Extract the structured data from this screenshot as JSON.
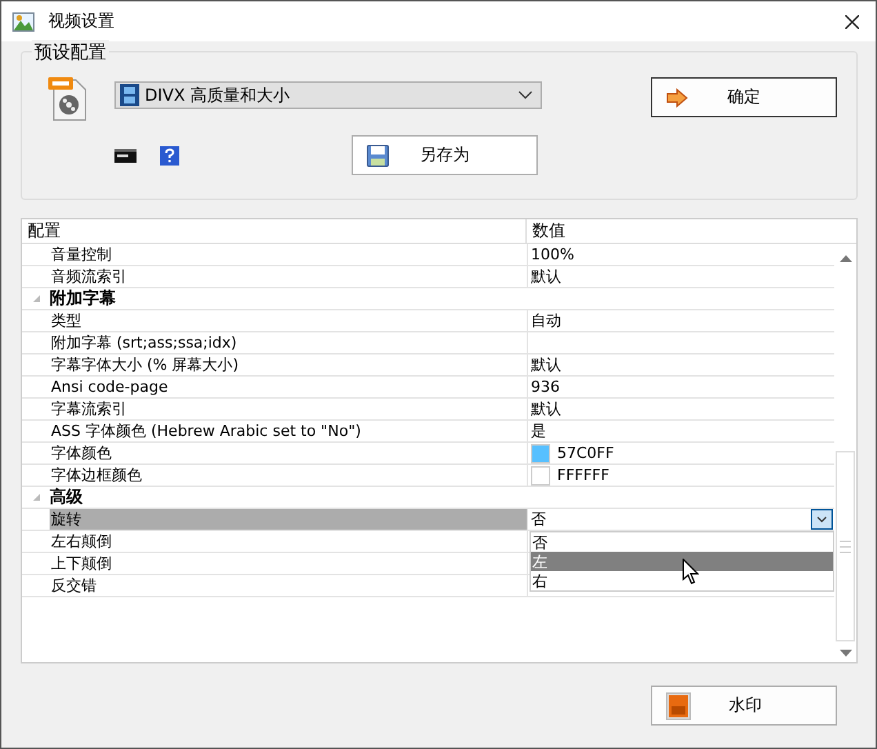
{
  "window": {
    "title": "视频设置"
  },
  "preset": {
    "legend": "预设配置",
    "combo_value": "DIVX 高质量和大小",
    "confirm_button": "确定",
    "save_as_button": "另存为"
  },
  "grid": {
    "columns": [
      "配置",
      "数值"
    ],
    "groups": [
      {
        "items": [
          {
            "name": "音量控制",
            "value": "100%",
            "selected": false
          },
          {
            "name": "音频流索引",
            "value": "默认",
            "selected": false
          }
        ]
      },
      {
        "title": "附加字幕",
        "expanded": true,
        "items": [
          {
            "name": "类型",
            "value": "自动",
            "selected": false
          },
          {
            "name": "附加字幕 (srt;ass;ssa;idx)",
            "selected": false
          },
          {
            "name": "字幕字体大小 (% 屏幕大小)",
            "value": "默认",
            "selected": false
          },
          {
            "name": "Ansi code-page",
            "value": "936",
            "selected": false
          },
          {
            "name": "字幕流索引",
            "value": "默认",
            "selected": false
          },
          {
            "name": "ASS 字体颜色 (Hebrew Arabic set to \"No\")",
            "value": "是",
            "selected": false
          },
          {
            "name": "字体颜色",
            "value": "57C0FF",
            "color": "#57c0ff",
            "selected": false
          },
          {
            "name": "字体边框颜色",
            "value": "FFFFFF",
            "color": "#ffffff",
            "selected": false
          }
        ]
      },
      {
        "title": "高级",
        "expanded": true,
        "items": [
          {
            "name": "旋转",
            "value": "否",
            "selected": true,
            "options": [
              {
                "label": "否",
                "highlighted": false
              },
              {
                "label": "左",
                "highlighted": true
              },
              {
                "label": "右",
                "highlighted": false
              }
            ]
          },
          {
            "name": "左右颠倒",
            "selected": false
          },
          {
            "name": "上下颠倒",
            "selected": false
          },
          {
            "name": "反交错",
            "selected": false
          }
        ]
      }
    ]
  },
  "watermark_button": "水印"
}
